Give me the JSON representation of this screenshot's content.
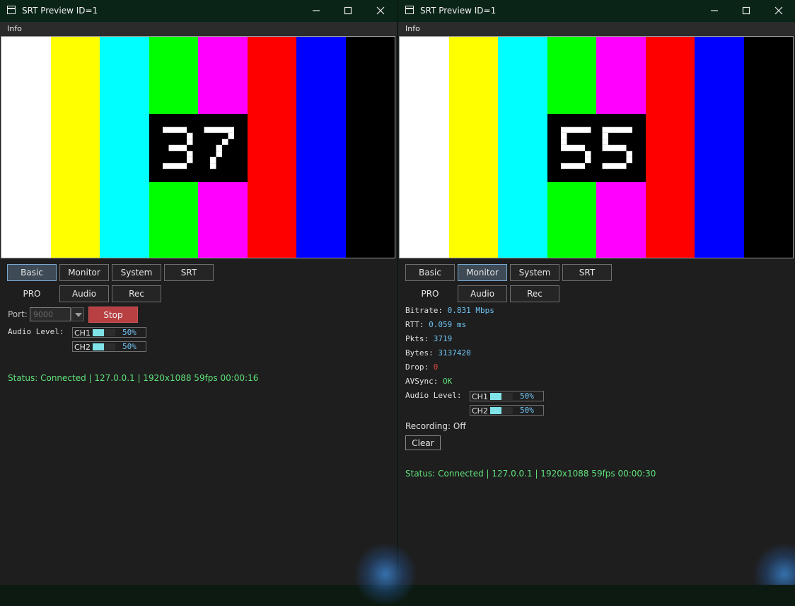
{
  "colors": {
    "title_bar": "#0a2417",
    "window_bg": "#1e1e1e",
    "status_green": "#5fe07a",
    "value_blue": "#6fc5f5",
    "stop_red": "#b83f42",
    "meter_fill": "#7fe3e8",
    "color_bars": [
      "#ffffff",
      "#ffff00",
      "#00ffff",
      "#00ff00",
      "#ff00ff",
      "#ff0000",
      "#0000ff",
      "#000000"
    ]
  },
  "icons": {
    "app": "window-icon",
    "minimize": "minimize-icon",
    "maximize": "maximize-icon",
    "close": "close-icon",
    "dropdown": "chevron-down-icon"
  },
  "windows": [
    {
      "title": "SRT Preview ID=1",
      "menu": "Info",
      "counter": "37",
      "tabs_row1": [
        "Basic",
        "Monitor",
        "System",
        "SRT"
      ],
      "tabs_row2": [
        "PRO",
        "Audio",
        "Rec"
      ],
      "active_tab": "Basic",
      "port_label": "Port:",
      "port_value": "9000",
      "stop_label": "Stop",
      "audio_label": "Audio Level:",
      "meters": [
        {
          "channel": "CH1",
          "level_pct": "50%",
          "level": 0.5
        },
        {
          "channel": "CH2",
          "level_pct": "50%",
          "level": 0.5
        }
      ],
      "status": "Status: Connected | 127.0.0.1 | 1920x1088 59fps 00:00:16"
    },
    {
      "title": "SRT Preview ID=1",
      "menu": "Info",
      "counter": "55",
      "tabs_row1": [
        "Basic",
        "Monitor",
        "System",
        "SRT"
      ],
      "tabs_row2": [
        "PRO",
        "Audio",
        "Rec"
      ],
      "active_tab": "Monitor",
      "metrics": {
        "bitrate_label": "Bitrate:",
        "bitrate": "0.831 Mbps",
        "rtt_label": "RTT:",
        "rtt": "0.059 ms",
        "pkts_label": "Pkts:",
        "pkts": "3719",
        "bytes_label": "Bytes:",
        "bytes": "3137420",
        "drop_label": "Drop:",
        "drop": "0",
        "avsync_label": "AVSync:",
        "avsync": "OK"
      },
      "audio_label": "Audio Level:",
      "meters": [
        {
          "channel": "CH1",
          "level_pct": "50%",
          "level": 0.5
        },
        {
          "channel": "CH2",
          "level_pct": "50%",
          "level": 0.5
        }
      ],
      "recording": "Recording: Off",
      "clear_label": "Clear",
      "status": "Status: Connected | 127.0.0.1 | 1920x1088 59fps 00:00:30"
    }
  ]
}
